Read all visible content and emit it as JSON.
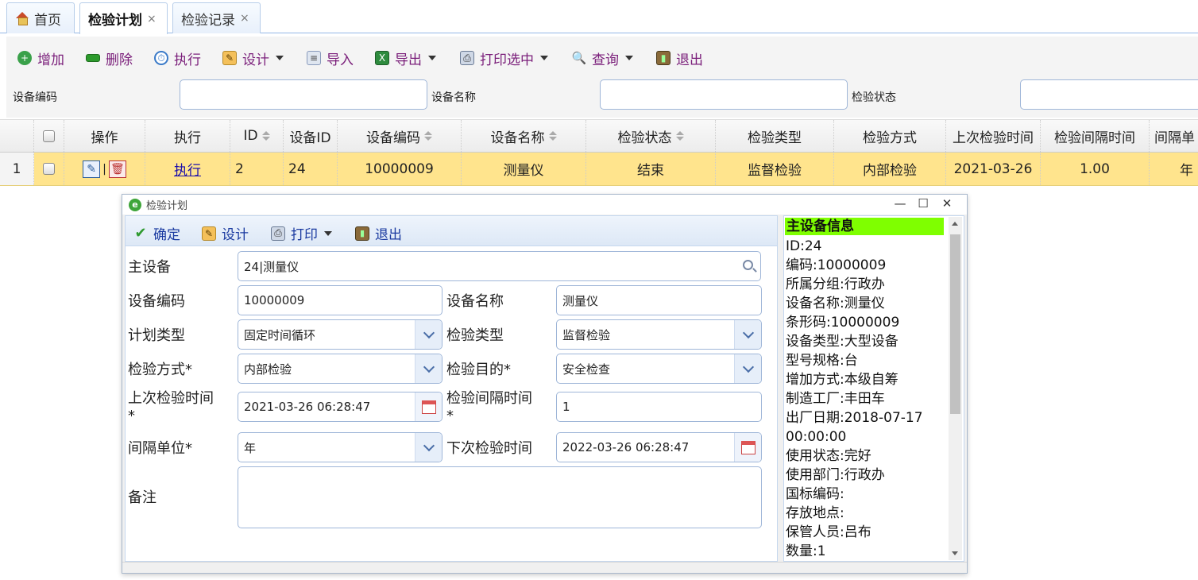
{
  "tabs": [
    {
      "label": "首页",
      "close": ""
    },
    {
      "label": "检验计划",
      "close": "×"
    },
    {
      "label": "检验记录",
      "close": "×"
    }
  ],
  "toolbar": {
    "add": "增加",
    "delete": "删除",
    "execute": "执行",
    "design": "设计",
    "import": "导入",
    "export": "导出",
    "print_selected": "打印选中",
    "query": "查询",
    "exit": "退出"
  },
  "search": {
    "device_code_label": "设备编码",
    "device_name_label": "设备名称",
    "inspect_status_label": "检验状态"
  },
  "grid": {
    "headers": {
      "op": "操作",
      "exec": "执行",
      "id": "ID",
      "device_id": "设备ID",
      "device_code": "设备编码",
      "device_name": "设备名称",
      "status": "检验状态",
      "type": "检验类型",
      "method": "检验方式",
      "last_time": "上次检验时间",
      "interval": "检验间隔时间",
      "unit": "间隔单"
    },
    "row": {
      "num": "1",
      "exec": "执行",
      "id": "2",
      "device_id": "24",
      "device_code": "10000009",
      "device_name": "测量仪",
      "status": "结束",
      "type": "监督检验",
      "method": "内部检验",
      "last_time": "2021-03-26",
      "interval": "1.00",
      "unit": "年"
    }
  },
  "dialog": {
    "title": "检验计划",
    "toolbar": {
      "confirm": "确定",
      "design": "设计",
      "print": "打印",
      "exit": "退出"
    },
    "labels": {
      "main_device": "主设备",
      "device_code": "设备编码",
      "device_name": "设备名称",
      "plan_type": "计划类型",
      "inspect_type": "检验类型",
      "inspect_method": "检验方式*",
      "inspect_purpose": "检验目的*",
      "last_time_1": "上次检验时间",
      "last_time_2": "*",
      "interval_1": "检验间隔时间",
      "interval_2": "*",
      "interval_unit": "间隔单位*",
      "next_time": "下次检验时间",
      "remark": "备注"
    },
    "values": {
      "main_device": "24|测量仪",
      "device_code": "10000009",
      "device_name": "测量仪",
      "plan_type": "固定时间循环",
      "inspect_type": "监督检验",
      "inspect_method": "内部检验",
      "inspect_purpose": "安全检查",
      "last_time": "2021-03-26 06:28:47",
      "interval": "1",
      "interval_unit": "年",
      "next_time": "2022-03-26 06:28:47",
      "remark": ""
    }
  },
  "info": {
    "title": "主设备信息",
    "lines": [
      "ID:24",
      "编码:10000009",
      "所属分组:行政办",
      "设备名称:测量仪",
      "条形码:10000009",
      "设备类型:大型设备",
      "型号规格:台",
      "增加方式:本级自筹",
      "制造工厂:丰田车",
      "出厂日期:2018-07-17",
      "00:00:00",
      "使用状态:完好",
      "使用部门:行政办",
      "国标编码:",
      "存放地点:",
      "保管人员:吕布",
      "数量:1"
    ]
  }
}
